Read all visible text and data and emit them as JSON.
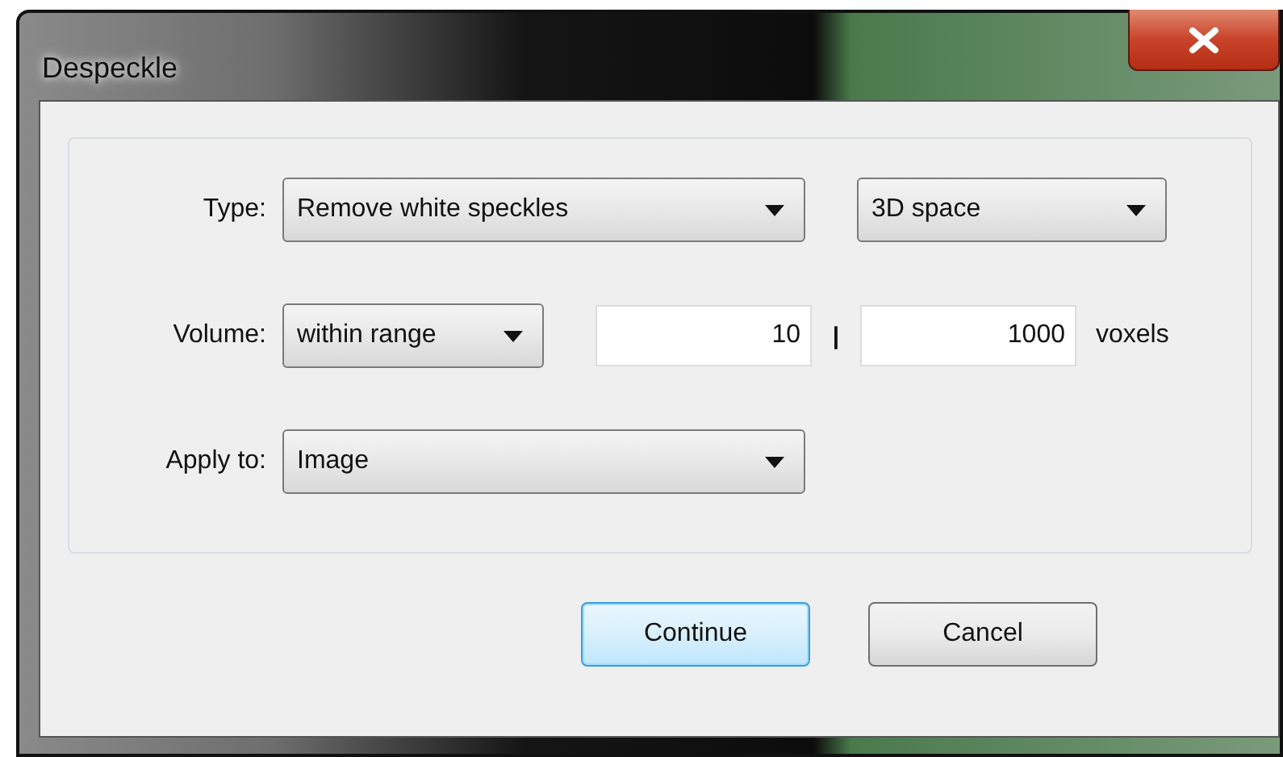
{
  "window": {
    "title": "Despeckle"
  },
  "rows": [
    {
      "label": "Type:",
      "controls": [
        {
          "kind": "dropdown",
          "value": "Remove white speckles"
        },
        {
          "kind": "dropdown",
          "value": "3D space"
        }
      ]
    },
    {
      "label": "Volume:",
      "controls": [
        {
          "kind": "dropdown",
          "value": "within range"
        },
        {
          "kind": "field",
          "value": "10"
        },
        {
          "kind": "separator",
          "text": "|"
        },
        {
          "kind": "field",
          "value": "1000"
        },
        {
          "kind": "unit",
          "text": "voxels"
        }
      ]
    },
    {
      "label": "Apply to:",
      "controls": [
        {
          "kind": "dropdown",
          "value": "Image"
        }
      ]
    }
  ],
  "buttons": [
    {
      "label": "Continue",
      "default": true
    },
    {
      "label": "Cancel",
      "default": false
    }
  ]
}
